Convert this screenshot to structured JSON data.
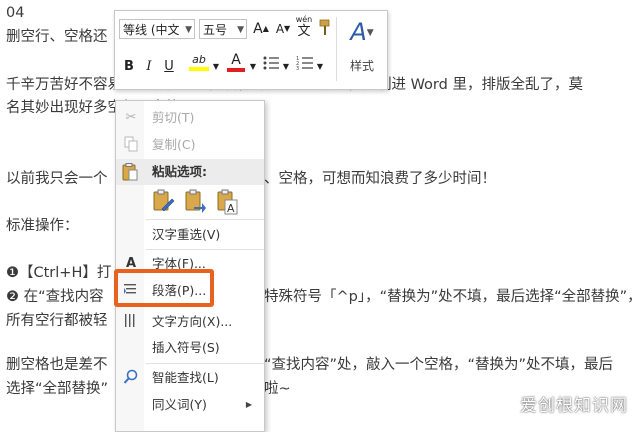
{
  "document": {
    "lines": [
      "04",
      "删空行、空格还",
      "千辛万苦好不容易找到了需要的资料，却是 PDF 版的，复制进 Word 里，排版全乱了，莫",
      "名其妙出现好多空行、空格。",
      "以前我只会一个",
      "、空格，可想而知浪费了多少时间！",
      "标准操作：",
      "❶【Ctrl+H】打",
      "❷ 在“查找内容",
      "特殊符号「^p」，“替换为”处不填，最后选择“全部替换”，",
      "所有空行都被轻",
      "删空格也是差不",
      "“查找内容”处，敲入一个空格，“替换为”处不填，最后",
      "选择“全部替换”",
      "啦~"
    ]
  },
  "mini_toolbar": {
    "font_name": "等线 (中文",
    "font_size": "五号",
    "grow_font": "A",
    "shrink_font": "A",
    "phonetic": "wén",
    "bold": "B",
    "italic": "I",
    "underline": "U",
    "highlight": "ab",
    "font_color": "A",
    "styles_label": "样式",
    "highlight_color": "#ffff00",
    "font_color_value": "#e02020"
  },
  "context_menu": {
    "items": {
      "cut": "剪切(T)",
      "copy": "复制(C)",
      "paste_header": "粘贴选项:",
      "reconvert": "汉字重选(V)",
      "font": "字体(F)...",
      "paragraph": "段落(P)...",
      "text_direction": "文字方向(X)...",
      "insert_symbol": "插入符号(S)",
      "smart_lookup": "智能查找(L)",
      "synonyms": "同义词(Y)"
    }
  },
  "watermark": "爱创根知识网",
  "highlight_color": "#e8621f"
}
